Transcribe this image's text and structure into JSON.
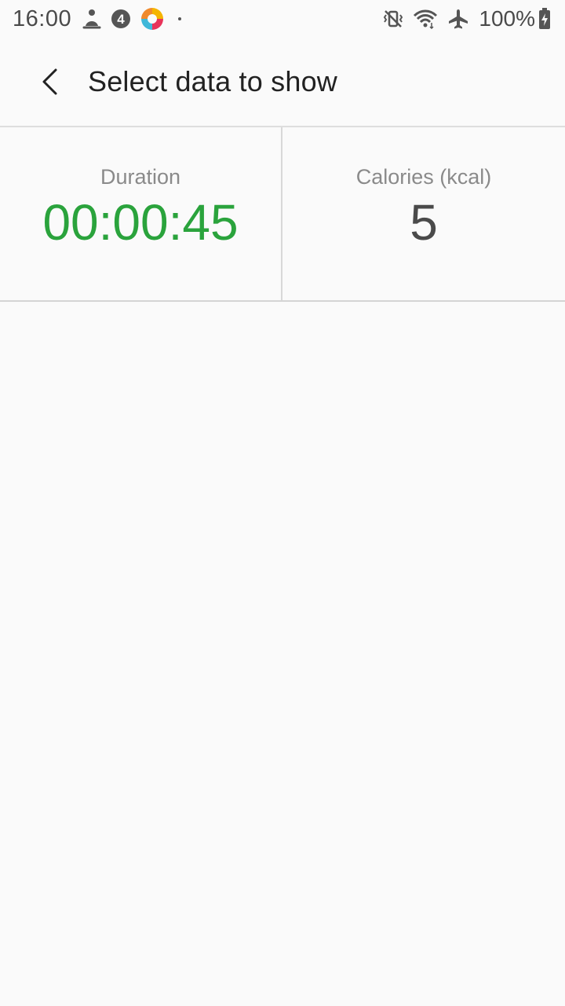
{
  "status_bar": {
    "time": "16:00",
    "battery_percent": "100%",
    "icons_left": [
      "meditation-icon",
      "four-badge-icon",
      "colorful-app-icon",
      "notification-dot-icon"
    ],
    "icons_right": [
      "vibrate-mute-icon",
      "wifi-icon",
      "airplane-icon",
      "battery-charging-icon"
    ]
  },
  "app_bar": {
    "title": "Select data to show",
    "back_icon": "chevron-left-icon"
  },
  "metrics": [
    {
      "label": "Duration",
      "value": "00:00:45",
      "color": "#2aa33c"
    },
    {
      "label": "Calories (kcal)",
      "value": "5",
      "color": "#4a4a4a"
    }
  ]
}
